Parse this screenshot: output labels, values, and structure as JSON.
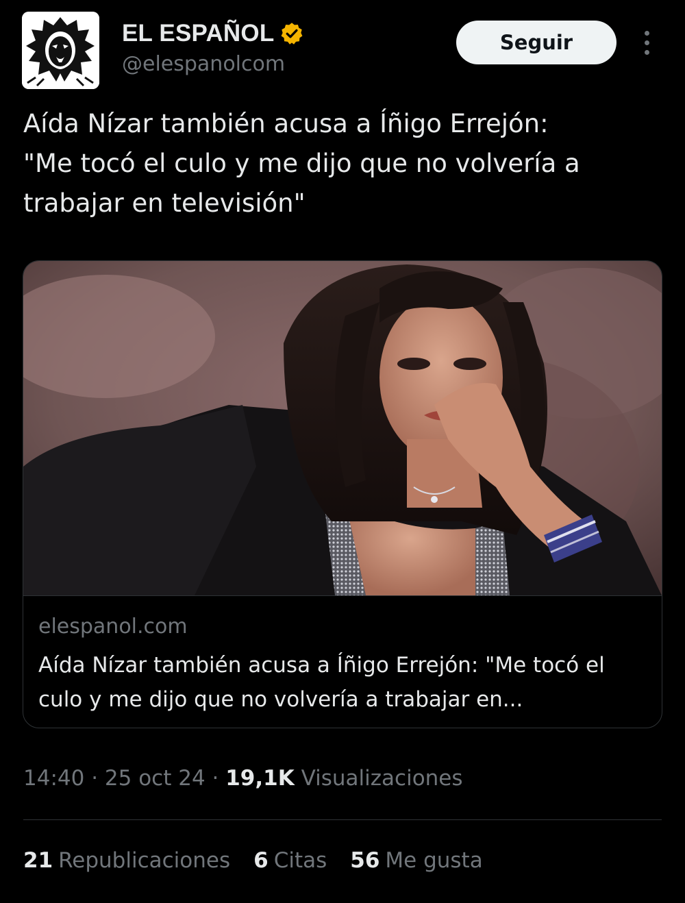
{
  "account": {
    "display_name": "EL ESPAÑOL",
    "handle": "@elespanolcom",
    "verified_color": "#f5b400",
    "avatar_icon": "lion-logo"
  },
  "actions": {
    "follow_label": "Seguir",
    "more_icon": "more-vertical-icon"
  },
  "tweet": {
    "text": "Aída Nízar también acusa a Íñigo Errejón:\n\"Me tocó el culo y me dijo que no volvería a\ntrabajar en televisión\""
  },
  "card": {
    "domain": "elespanol.com",
    "title": "Aída Nízar también acusa a Íñigo Errejón: \"Me tocó el\nculo y me dijo que no volvería a trabajar en..."
  },
  "meta": {
    "time": "14:40",
    "separator": " · ",
    "date": "25 oct 24",
    "views_count": "19,1K",
    "views_label": "Visualizaciones"
  },
  "stats": {
    "reposts_count": "21",
    "reposts_label": "Republicaciones",
    "quotes_count": "6",
    "quotes_label": "Citas",
    "likes_count": "56",
    "likes_label": "Me gusta"
  },
  "colors": {
    "background": "#000000",
    "text_primary": "#e7e9ea",
    "text_secondary": "#71767b",
    "border": "#2f3336",
    "button_bg": "#eff3f4"
  }
}
